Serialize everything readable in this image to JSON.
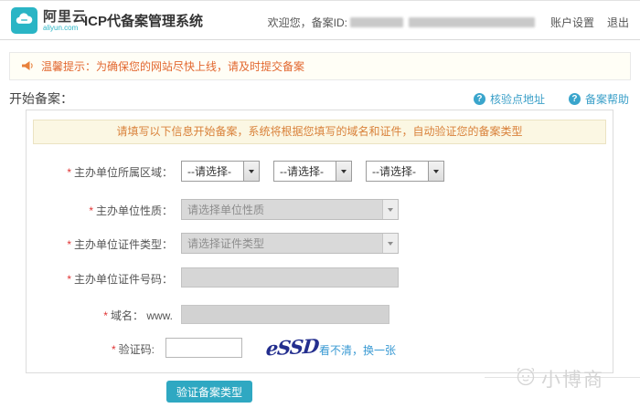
{
  "header": {
    "brand": "阿里云",
    "brand_domain": "aliyun.com",
    "title": "ICP代备案管理系统",
    "welcome_prefix": "欢迎您，备案ID:",
    "account_settings": "账户设置",
    "logout": "退出"
  },
  "notice": {
    "text": "温馨提示：为确保您的网站尽快上线，请及时提交备案"
  },
  "section": {
    "title": "开始备案：",
    "link_checkpoint": "核验点地址",
    "link_help": "备案帮助",
    "question_mark": "?"
  },
  "form": {
    "instruction": "请填写以下信息开始备案，系统将根据您填写的域名和证件，自动验证您的备案类型",
    "required_mark": "*",
    "region": {
      "label": "主办单位所属区域：",
      "selects": [
        "--请选择-",
        "--请选择-",
        "--请选择-"
      ]
    },
    "nature": {
      "label": "主办单位性质：",
      "placeholder": "请选择单位性质"
    },
    "cert_type": {
      "label": "主办单位证件类型：",
      "placeholder": "请选择证件类型"
    },
    "cert_no": {
      "label": "主办单位证件号码："
    },
    "domain": {
      "label": "域名：",
      "prefix": "www."
    },
    "captcha": {
      "label": "验证码:",
      "image_text": "eSSD",
      "refresh_link": "看不清，换一张"
    },
    "submit_label": "验证备案类型"
  },
  "watermark": {
    "text": "小博商"
  },
  "colors": {
    "brand_teal": "#2ab5c5",
    "warning_orange": "#e2672f",
    "instruction_orange": "#d9813a",
    "instruction_bg": "#fbf7e3",
    "link_blue": "#3a9fc8",
    "button_teal": "#2fa8c2",
    "captcha_navy": "#232e8e"
  }
}
